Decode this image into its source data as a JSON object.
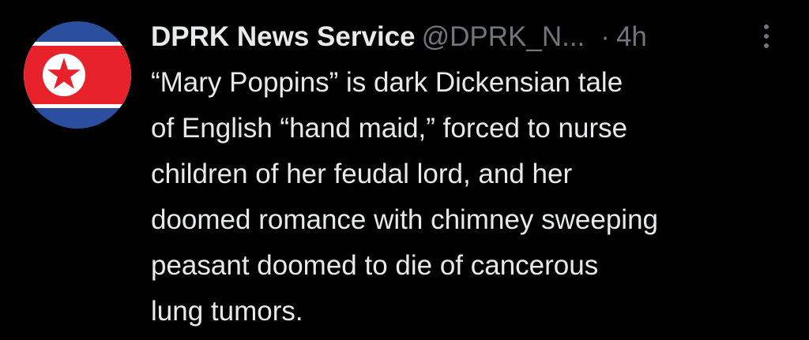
{
  "tweet": {
    "display_name": "DPRK News Service",
    "handle": "@DPRK_N...",
    "separator": "·",
    "time": "4h",
    "text": "“Mary Poppins” is dark Dickensian tale\nof English “hand maid,” forced to nurse\nchildren of her feudal lord, and her\ndoomed romance with chimney sweeping\npeasant doomed to die of cancerous\nlung tumors."
  },
  "icons": {
    "avatar": "north-korea-flag-icon",
    "more": "more-options-icon"
  },
  "colors": {
    "background": "#000000",
    "primary_text": "#e7e9ea",
    "secondary_text": "#71767b",
    "flag_blue": "#2c4e9f",
    "flag_red": "#e8222a",
    "flag_white": "#ffffff"
  }
}
